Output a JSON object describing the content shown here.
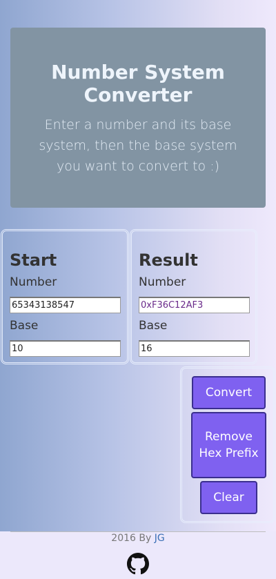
{
  "hero": {
    "title": "Number System Converter",
    "subtitle": "Enter a number and its base system, then the base system you want to convert to :)"
  },
  "start": {
    "heading": "Start",
    "number_label": "Number",
    "number_value": "65343138547",
    "base_label": "Base",
    "base_value": "10"
  },
  "result": {
    "heading": "Result",
    "number_label": "Number",
    "number_value": "0xF36C12AF3",
    "base_label": "Base",
    "base_value": "16"
  },
  "actions": {
    "convert_label": "Convert",
    "remove_prefix_label": "Remove Hex Prefix",
    "clear_label": "Clear"
  },
  "footer": {
    "credit_prefix": "2016 By ",
    "author_link": "JG",
    "icon": "github-icon"
  },
  "colors": {
    "hero_bg": "#8294a3",
    "button_bg": "#7f61f0",
    "button_border": "#3a2e8e",
    "link": "#3a6fb5"
  }
}
